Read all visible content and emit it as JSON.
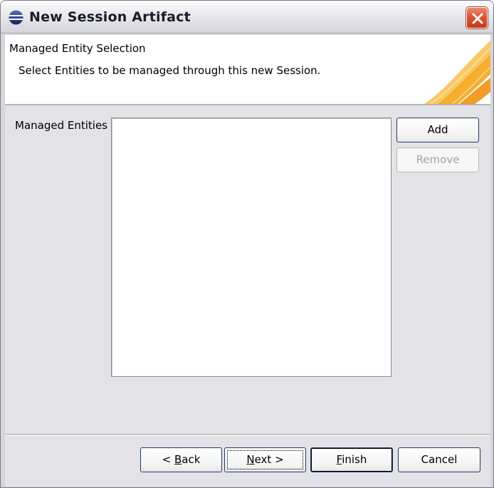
{
  "window": {
    "title": "New Session Artifact"
  },
  "header": {
    "title": "Managed Entity Selection",
    "description": "Select Entities to be managed through this new Session."
  },
  "content": {
    "entities_label": "Managed Entities",
    "add_label": "Add",
    "remove_label": "Remove",
    "entities": []
  },
  "footer": {
    "back": {
      "prefix": "< ",
      "mnemonic": "B",
      "rest": "ack"
    },
    "next": {
      "mnemonic": "N",
      "rest": "ext >"
    },
    "finish": {
      "mnemonic": "F",
      "rest": "inish"
    },
    "cancel": "Cancel"
  },
  "colors": {
    "window_bg": "#d6d5d9",
    "content_bg": "#e3e2e6",
    "close_button": "#d9502f",
    "banner_accent": "#f4a71c",
    "button_border": "#1f3a6b"
  },
  "icons": {
    "app": "eclipse-icon",
    "close": "close-icon",
    "banner": "wizard-banner-graphic"
  }
}
